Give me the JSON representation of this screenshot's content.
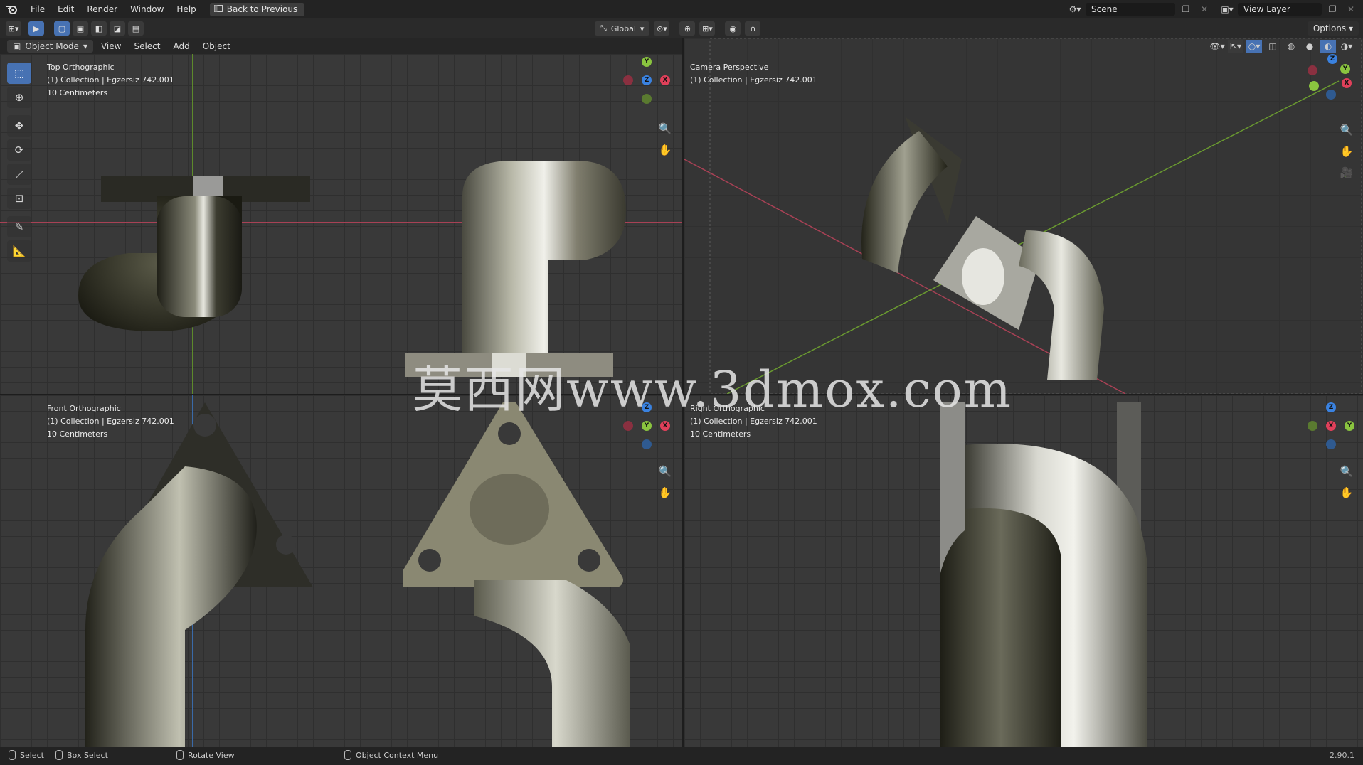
{
  "menu": {
    "items": [
      "File",
      "Edit",
      "Render",
      "Window",
      "Help"
    ],
    "back_label": "Back to Previous"
  },
  "scene": {
    "scene_name": "Scene",
    "view_layer": "View Layer"
  },
  "toolrow": {
    "transform_orientation": "Global",
    "options_label": "Options"
  },
  "viewport_header": {
    "mode": "Object Mode",
    "menus": [
      "View",
      "Select",
      "Add",
      "Object"
    ]
  },
  "viewports": {
    "top": {
      "title": "Top Orthographic",
      "collection": "(1) Collection | Egzersiz 742.001",
      "scale": "10 Centimeters"
    },
    "camera": {
      "title": "Camera Perspective",
      "collection": "(1) Collection | Egzersiz 742.001"
    },
    "front": {
      "title": "Front Orthographic",
      "collection": "(1) Collection | Egzersiz 742.001",
      "scale": "10 Centimeters"
    },
    "right": {
      "title": "Right Orthographic",
      "collection": "(1) Collection | Egzersiz 742.001",
      "scale": "10 Centimeters"
    }
  },
  "gizmo_labels": {
    "x": "X",
    "y": "Y",
    "z": "Z"
  },
  "watermark": "莫西网www.3dmox.com",
  "statusbar": {
    "select": "Select",
    "box_select": "Box Select",
    "rotate_view": "Rotate View",
    "context_menu": "Object Context Menu",
    "version": "2.90.1"
  },
  "colors": {
    "accent": "#4772b3",
    "axis_x": "#e0405a",
    "axis_y": "#7fb83d",
    "axis_z": "#3a82e0"
  },
  "icons": [
    "blender-logo-icon",
    "back-icon",
    "select-box-icon",
    "cursor-icon",
    "move-icon",
    "rotate-icon",
    "scale-icon",
    "transform-icon",
    "annotate-icon",
    "measure-icon",
    "zoom-icon",
    "hand-pan-icon",
    "camera-icon",
    "chevron-down-icon"
  ]
}
